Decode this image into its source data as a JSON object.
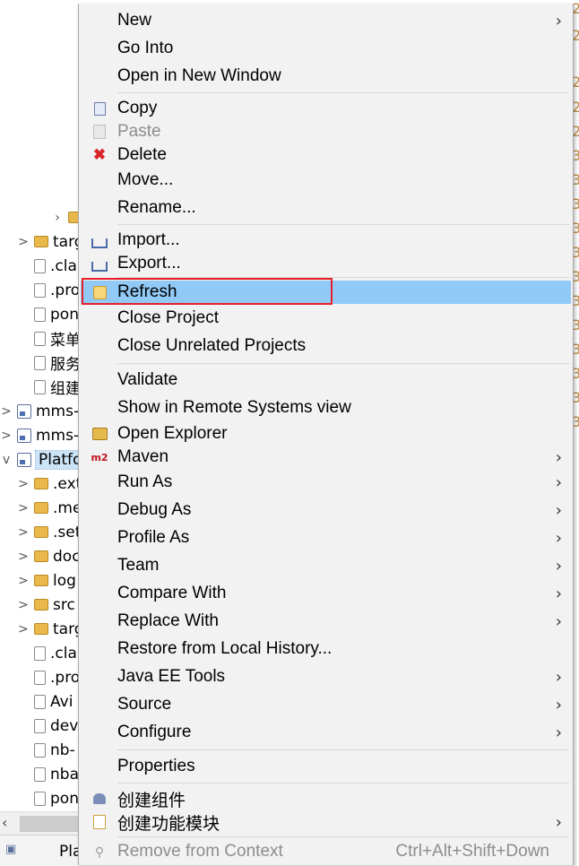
{
  "explorer": {
    "rows": [
      {
        "label": "targ",
        "chevron": ">",
        "icon": "folder"
      },
      {
        "label": ".cla",
        "chevron": "",
        "icon": "file"
      },
      {
        "label": ".pro",
        "chevron": "",
        "icon": "file"
      },
      {
        "label": "pon",
        "chevron": "",
        "icon": "file"
      },
      {
        "label": "菜单",
        "chevron": "",
        "icon": "file"
      },
      {
        "label": "服务",
        "chevron": "",
        "icon": "file"
      },
      {
        "label": "组建",
        "chevron": "",
        "icon": "file"
      },
      {
        "label": "mms-",
        "chevron": ">",
        "icon": "proj"
      },
      {
        "label": "mms-",
        "chevron": ">",
        "icon": "proj"
      },
      {
        "label": "Platfo",
        "chevron": "v",
        "icon": "proj"
      },
      {
        "label": ".ext",
        "chevron": ">",
        "icon": "folder"
      },
      {
        "label": ".me",
        "chevron": ">",
        "icon": "folder"
      },
      {
        "label": ".set",
        "chevron": ">",
        "icon": "folder"
      },
      {
        "label": "doc",
        "chevron": ">",
        "icon": "folder"
      },
      {
        "label": "log",
        "chevron": ">",
        "icon": "folder"
      },
      {
        "label": "src",
        "chevron": ">",
        "icon": "folder"
      },
      {
        "label": "targ",
        "chevron": ">",
        "icon": "folder"
      },
      {
        "label": ".cla",
        "chevron": "",
        "icon": "file"
      },
      {
        "label": ".pro",
        "chevron": "",
        "icon": "file"
      },
      {
        "label": "Avi",
        "chevron": "",
        "icon": "file"
      },
      {
        "label": "dev",
        "chevron": "",
        "icon": "file"
      },
      {
        "label": "nb-",
        "chevron": "",
        "icon": "file"
      },
      {
        "label": "nba",
        "chevron": "",
        "icon": "file"
      },
      {
        "label": "pon",
        "chevron": "",
        "icon": "file"
      }
    ],
    "bottom_label": "Pla",
    "right_digits": [
      "2",
      "2",
      "2",
      "2",
      "2",
      "3",
      "3",
      "3",
      "3",
      "3",
      "3",
      "3",
      "3",
      "3",
      "3",
      "3",
      "3"
    ]
  },
  "context_menu": {
    "items": [
      {
        "label": "New",
        "submenu": true
      },
      {
        "label": "Go Into"
      },
      {
        "label": "Open in New Window"
      },
      {
        "label": "Copy",
        "icon": "copy-icon"
      },
      {
        "label": "Paste",
        "icon": "paste-icon",
        "disabled": true
      },
      {
        "label": "Delete",
        "icon": "delete-icon"
      },
      {
        "label": "Move..."
      },
      {
        "label": "Rename..."
      },
      {
        "label": "Import...",
        "icon": "import-icon"
      },
      {
        "label": "Export...",
        "icon": "export-icon"
      },
      {
        "label": "Refresh",
        "icon": "refresh-icon",
        "highlighted": true
      },
      {
        "label": "Close Project"
      },
      {
        "label": "Close Unrelated Projects"
      },
      {
        "label": "Validate"
      },
      {
        "label": "Show in Remote Systems view"
      },
      {
        "label": "Open Explorer",
        "icon": "explorer-icon"
      },
      {
        "label": "Maven",
        "icon": "maven-icon",
        "submenu": true
      },
      {
        "label": "Run As",
        "submenu": true
      },
      {
        "label": "Debug As",
        "submenu": true
      },
      {
        "label": "Profile As",
        "submenu": true
      },
      {
        "label": "Team",
        "submenu": true
      },
      {
        "label": "Compare With",
        "submenu": true
      },
      {
        "label": "Replace With",
        "submenu": true
      },
      {
        "label": "Restore from Local History..."
      },
      {
        "label": "Java EE Tools",
        "submenu": true
      },
      {
        "label": "Source",
        "submenu": true
      },
      {
        "label": "Configure",
        "submenu": true
      },
      {
        "label": "Properties"
      },
      {
        "label": "创建组件",
        "icon": "component-icon"
      },
      {
        "label": "创建功能模块",
        "icon": "module-icon",
        "submenu": true
      },
      {
        "label": "Remove from Context",
        "icon": "remove-context-icon",
        "disabled": true,
        "accelerator": "Ctrl+Alt+Shift+Down"
      }
    ],
    "maven_icon_text": "m2",
    "submenu_glyph": "›",
    "highlight_color": "#91c9f7",
    "focus_outline_color": "#e8202a"
  },
  "colors": {
    "menu_background": "#f2f2f2",
    "disabled_text": "#8d8d8d",
    "delete_icon": "#d9252b"
  }
}
